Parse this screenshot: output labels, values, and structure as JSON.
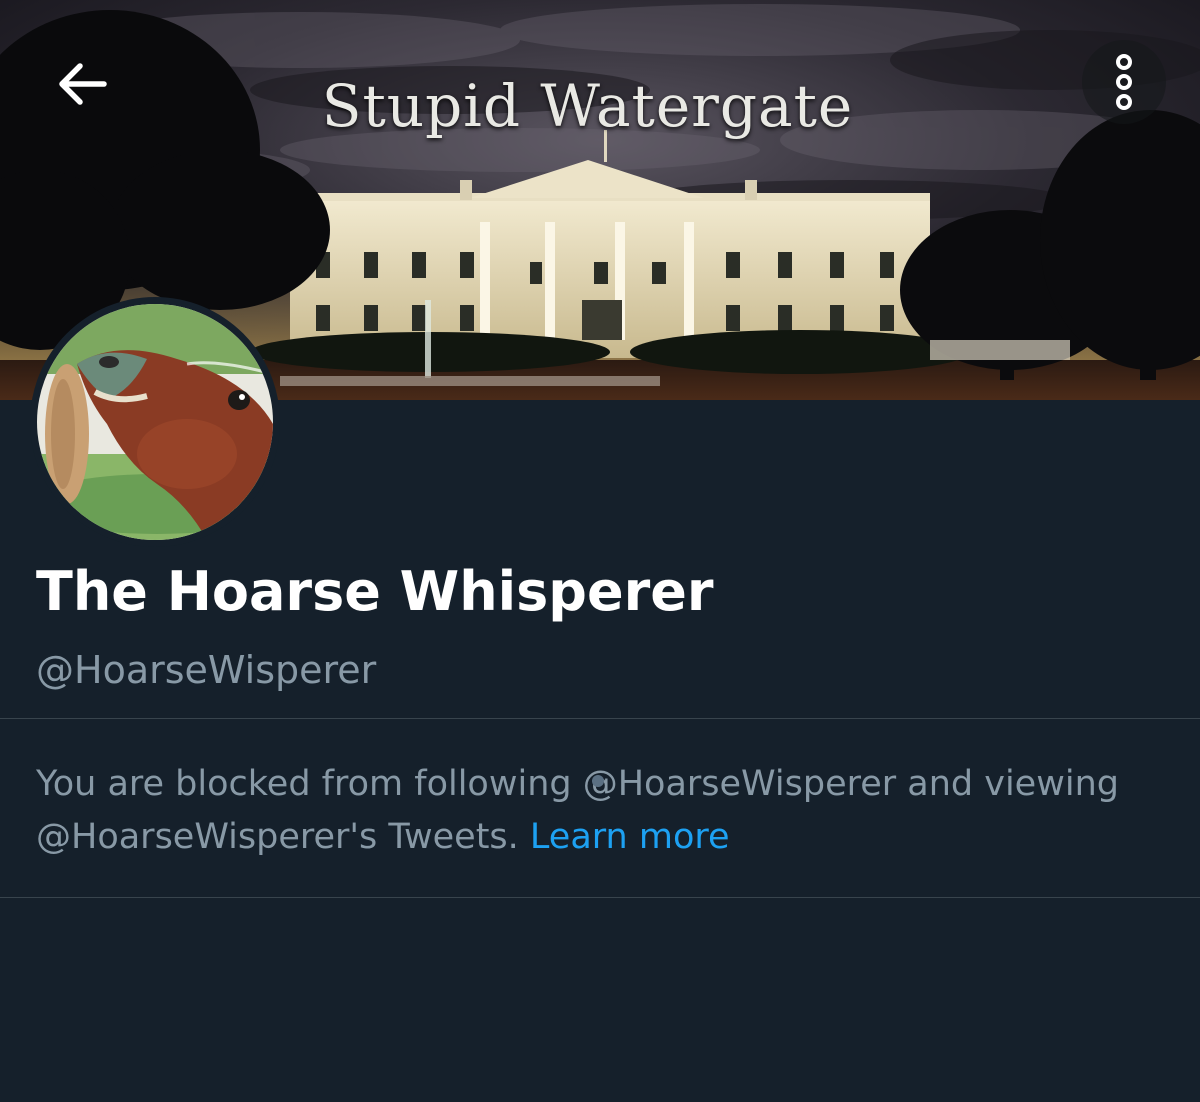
{
  "header": {
    "banner_text": "Stupid Watergate",
    "back_icon": "arrow-left-icon",
    "more_icon": "more-vertical-icon"
  },
  "profile": {
    "display_name": "The Hoarse Whisperer",
    "handle": "@HoarseWisperer"
  },
  "blocked_notice": {
    "message": "You are blocked from following @HoarseWisperer and viewing @HoarseWisperer's Tweets.",
    "link_label": "Learn more"
  },
  "colors": {
    "background": "#15202b",
    "divider": "#38444d",
    "secondary_text": "#8899a6",
    "link": "#1da1f2"
  }
}
